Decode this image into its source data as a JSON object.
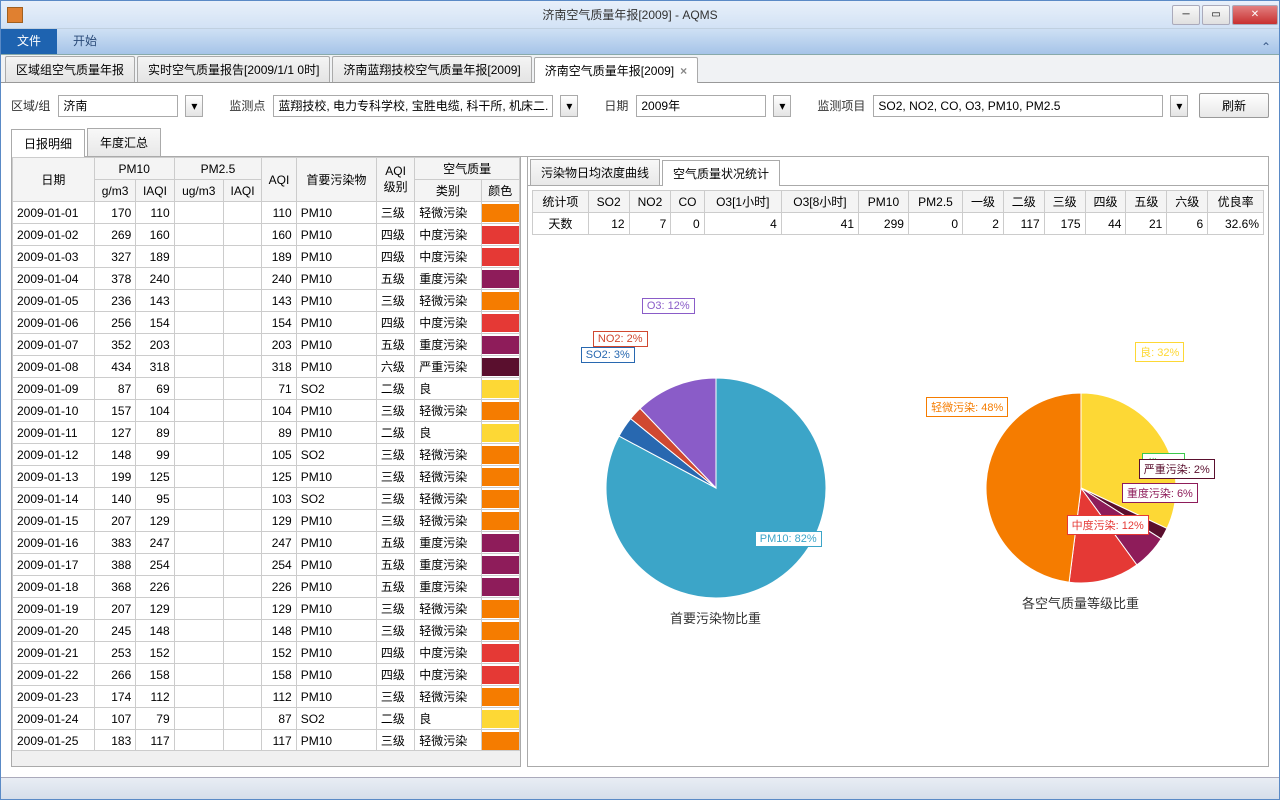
{
  "window": {
    "title": "济南空气质量年报[2009] - AQMS"
  },
  "ribbon": {
    "file": "文件",
    "start": "开始"
  },
  "doc_tabs": [
    "区域组空气质量年报",
    "实时空气质量报告[2009/1/1 0时]",
    "济南蓝翔技校空气质量年报[2009]",
    "济南空气质量年报[2009]"
  ],
  "filters": {
    "region_label": "区域/组",
    "region_value": "济南",
    "station_label": "监测点",
    "station_value": "蓝翔技校, 电力专科学校, 宝胜电缆, 科干所, 机床二...",
    "date_label": "日期",
    "date_value": "2009年",
    "item_label": "监测项目",
    "item_value": "SO2, NO2, CO, O3, PM10, PM2.5",
    "refresh": "刷新"
  },
  "inner_tabs": {
    "detail": "日报明细",
    "summary": "年度汇总"
  },
  "grid_header": {
    "date": "日期",
    "pm10": "PM10",
    "pm25": "PM2.5",
    "gm3": "g/m3",
    "iaqi": "IAQI",
    "ugm3": "ug/m3",
    "aqi": "AQI",
    "primary": "首要污染物",
    "level": "AQI\n级别",
    "air": "空气质量",
    "cat": "类别",
    "color": "颜色"
  },
  "rows": [
    {
      "date": "2009-01-01",
      "pm10g": 170,
      "pm10i": 110,
      "aqi": 110,
      "pri": "PM10",
      "lvl": "三级",
      "cat": "轻微污染",
      "clr": "#f57c00"
    },
    {
      "date": "2009-01-02",
      "pm10g": 269,
      "pm10i": 160,
      "aqi": 160,
      "pri": "PM10",
      "lvl": "四级",
      "cat": "中度污染",
      "clr": "#e53935"
    },
    {
      "date": "2009-01-03",
      "pm10g": 327,
      "pm10i": 189,
      "aqi": 189,
      "pri": "PM10",
      "lvl": "四级",
      "cat": "中度污染",
      "clr": "#e53935"
    },
    {
      "date": "2009-01-04",
      "pm10g": 378,
      "pm10i": 240,
      "aqi": 240,
      "pri": "PM10",
      "lvl": "五级",
      "cat": "重度污染",
      "clr": "#8e1c5a"
    },
    {
      "date": "2009-01-05",
      "pm10g": 236,
      "pm10i": 143,
      "aqi": 143,
      "pri": "PM10",
      "lvl": "三级",
      "cat": "轻微污染",
      "clr": "#f57c00"
    },
    {
      "date": "2009-01-06",
      "pm10g": 256,
      "pm10i": 154,
      "aqi": 154,
      "pri": "PM10",
      "lvl": "四级",
      "cat": "中度污染",
      "clr": "#e53935"
    },
    {
      "date": "2009-01-07",
      "pm10g": 352,
      "pm10i": 203,
      "aqi": 203,
      "pri": "PM10",
      "lvl": "五级",
      "cat": "重度污染",
      "clr": "#8e1c5a"
    },
    {
      "date": "2009-01-08",
      "pm10g": 434,
      "pm10i": 318,
      "aqi": 318,
      "pri": "PM10",
      "lvl": "六级",
      "cat": "严重污染",
      "clr": "#5a0f2e"
    },
    {
      "date": "2009-01-09",
      "pm10g": 87,
      "pm10i": 69,
      "aqi": 71,
      "pri": "SO2",
      "lvl": "二级",
      "cat": "良",
      "clr": "#fdd835"
    },
    {
      "date": "2009-01-10",
      "pm10g": 157,
      "pm10i": 104,
      "aqi": 104,
      "pri": "PM10",
      "lvl": "三级",
      "cat": "轻微污染",
      "clr": "#f57c00"
    },
    {
      "date": "2009-01-11",
      "pm10g": 127,
      "pm10i": 89,
      "aqi": 89,
      "pri": "PM10",
      "lvl": "二级",
      "cat": "良",
      "clr": "#fdd835"
    },
    {
      "date": "2009-01-12",
      "pm10g": 148,
      "pm10i": 99,
      "aqi": 105,
      "pri": "SO2",
      "lvl": "三级",
      "cat": "轻微污染",
      "clr": "#f57c00"
    },
    {
      "date": "2009-01-13",
      "pm10g": 199,
      "pm10i": 125,
      "aqi": 125,
      "pri": "PM10",
      "lvl": "三级",
      "cat": "轻微污染",
      "clr": "#f57c00"
    },
    {
      "date": "2009-01-14",
      "pm10g": 140,
      "pm10i": 95,
      "aqi": 103,
      "pri": "SO2",
      "lvl": "三级",
      "cat": "轻微污染",
      "clr": "#f57c00"
    },
    {
      "date": "2009-01-15",
      "pm10g": 207,
      "pm10i": 129,
      "aqi": 129,
      "pri": "PM10",
      "lvl": "三级",
      "cat": "轻微污染",
      "clr": "#f57c00"
    },
    {
      "date": "2009-01-16",
      "pm10g": 383,
      "pm10i": 247,
      "aqi": 247,
      "pri": "PM10",
      "lvl": "五级",
      "cat": "重度污染",
      "clr": "#8e1c5a"
    },
    {
      "date": "2009-01-17",
      "pm10g": 388,
      "pm10i": 254,
      "aqi": 254,
      "pri": "PM10",
      "lvl": "五级",
      "cat": "重度污染",
      "clr": "#8e1c5a"
    },
    {
      "date": "2009-01-18",
      "pm10g": 368,
      "pm10i": 226,
      "aqi": 226,
      "pri": "PM10",
      "lvl": "五级",
      "cat": "重度污染",
      "clr": "#8e1c5a"
    },
    {
      "date": "2009-01-19",
      "pm10g": 207,
      "pm10i": 129,
      "aqi": 129,
      "pri": "PM10",
      "lvl": "三级",
      "cat": "轻微污染",
      "clr": "#f57c00"
    },
    {
      "date": "2009-01-20",
      "pm10g": 245,
      "pm10i": 148,
      "aqi": 148,
      "pri": "PM10",
      "lvl": "三级",
      "cat": "轻微污染",
      "clr": "#f57c00"
    },
    {
      "date": "2009-01-21",
      "pm10g": 253,
      "pm10i": 152,
      "aqi": 152,
      "pri": "PM10",
      "lvl": "四级",
      "cat": "中度污染",
      "clr": "#e53935"
    },
    {
      "date": "2009-01-22",
      "pm10g": 266,
      "pm10i": 158,
      "aqi": 158,
      "pri": "PM10",
      "lvl": "四级",
      "cat": "中度污染",
      "clr": "#e53935"
    },
    {
      "date": "2009-01-23",
      "pm10g": 174,
      "pm10i": 112,
      "aqi": 112,
      "pri": "PM10",
      "lvl": "三级",
      "cat": "轻微污染",
      "clr": "#f57c00"
    },
    {
      "date": "2009-01-24",
      "pm10g": 107,
      "pm10i": 79,
      "aqi": 87,
      "pri": "SO2",
      "lvl": "二级",
      "cat": "良",
      "clr": "#fdd835"
    },
    {
      "date": "2009-01-25",
      "pm10g": 183,
      "pm10i": 117,
      "aqi": 117,
      "pri": "PM10",
      "lvl": "三级",
      "cat": "轻微污染",
      "clr": "#f57c00"
    }
  ],
  "right": {
    "tab1": "污染物日均浓度曲线",
    "tab2": "空气质量状况统计",
    "stats_header": [
      "统计项",
      "SO2",
      "NO2",
      "CO",
      "O3[1小时]",
      "O3[8小时]",
      "PM10",
      "PM2.5",
      "一级",
      "二级",
      "三级",
      "四级",
      "五级",
      "六级",
      "优良率"
    ],
    "stats_row": [
      "天数",
      "12",
      "7",
      "0",
      "4",
      "41",
      "299",
      "0",
      "2",
      "117",
      "175",
      "44",
      "21",
      "6",
      "32.6%"
    ]
  },
  "chart_data": [
    {
      "type": "pie",
      "title": "首要污染物比重",
      "series": [
        {
          "name": "PM10",
          "value": 82,
          "label": "PM10: 82%",
          "color": "#3ca5c8"
        },
        {
          "name": "SO2",
          "value": 3,
          "label": "SO2: 3%",
          "color": "#2868b0"
        },
        {
          "name": "NO2",
          "value": 2,
          "label": "NO2: 2%",
          "color": "#d04830"
        },
        {
          "name": "O3",
          "value": 12,
          "label": "O3: 12%",
          "color": "#8a5cc8"
        }
      ]
    },
    {
      "type": "pie",
      "title": "各空气质量等级比重",
      "series": [
        {
          "name": "良",
          "value": 32,
          "label": "良: 32%",
          "color": "#fdd835"
        },
        {
          "name": "优",
          "value": 0,
          "label": "优: 2%",
          "color": "#3cc84c"
        },
        {
          "name": "严重污染",
          "value": 2,
          "label": "严重污染: 2%",
          "color": "#5a0f2e"
        },
        {
          "name": "重度污染",
          "value": 6,
          "label": "重度污染: 6%",
          "color": "#8e1c5a"
        },
        {
          "name": "中度污染",
          "value": 12,
          "label": "中度污染: 12%",
          "color": "#e53935"
        },
        {
          "name": "轻微污染",
          "value": 48,
          "label": "轻微污染: 48%",
          "color": "#f57c00"
        }
      ]
    }
  ]
}
